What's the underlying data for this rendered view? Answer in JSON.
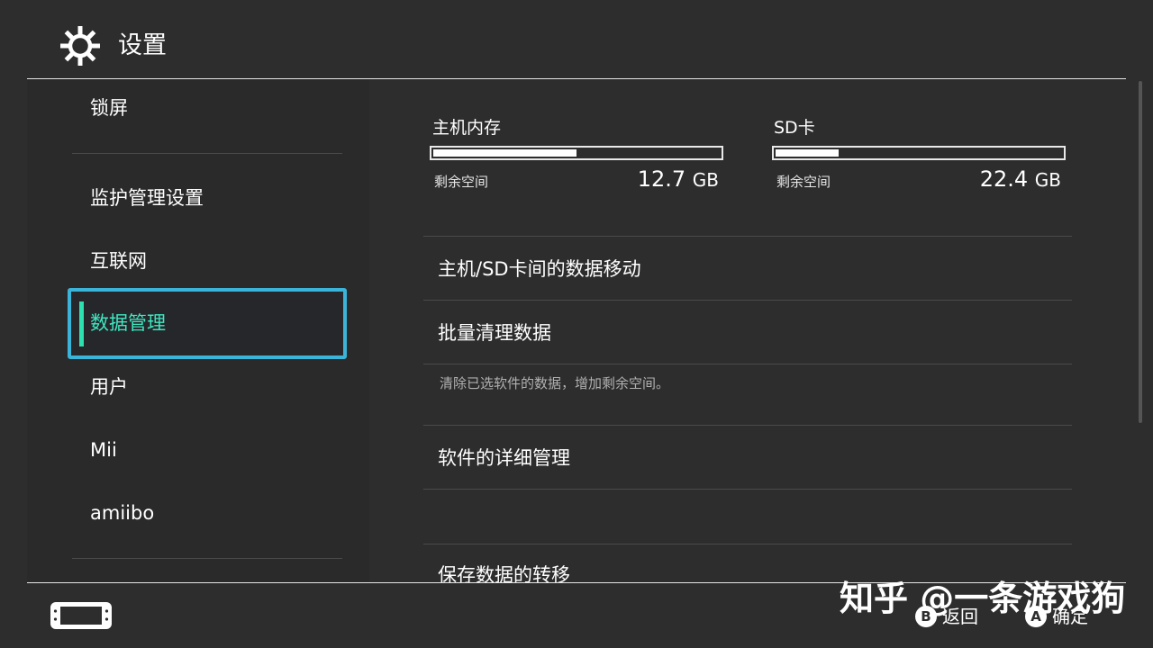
{
  "header": {
    "title": "设置",
    "icon": "gear-icon"
  },
  "sidebar": {
    "items": [
      {
        "label": "锁屏"
      },
      {
        "label": "监护管理设置"
      },
      {
        "label": "互联网"
      },
      {
        "label": "数据管理"
      },
      {
        "label": "用户"
      },
      {
        "label": "Mii"
      },
      {
        "label": "amiibo"
      }
    ],
    "selected_index": 3
  },
  "storage": {
    "console": {
      "label": "主机内存",
      "free_label": "剩余空间",
      "free_value": "12.7",
      "unit": "GB",
      "used_fraction": 0.5
    },
    "sd": {
      "label": "SD卡",
      "free_label": "剩余空间",
      "free_value": "22.4",
      "unit": "GB",
      "used_fraction": 0.22
    }
  },
  "options": [
    {
      "label": "主机/SD卡间的数据移动"
    },
    {
      "label": "批量清理数据",
      "description": "清除已选软件的数据，增加剩余空间。"
    },
    {
      "label": "软件的详细管理"
    },
    {
      "label": "保存数据的转移"
    }
  ],
  "footer": {
    "watermark": "知乎 @一条游戏狗",
    "back": {
      "button": "B",
      "label": "返回"
    },
    "ok": {
      "button": "A",
      "label": "确定"
    }
  },
  "colors": {
    "background": "#2d2d2d",
    "accent_border": "#3ab4d8",
    "accent_text": "#3fe6c0"
  }
}
